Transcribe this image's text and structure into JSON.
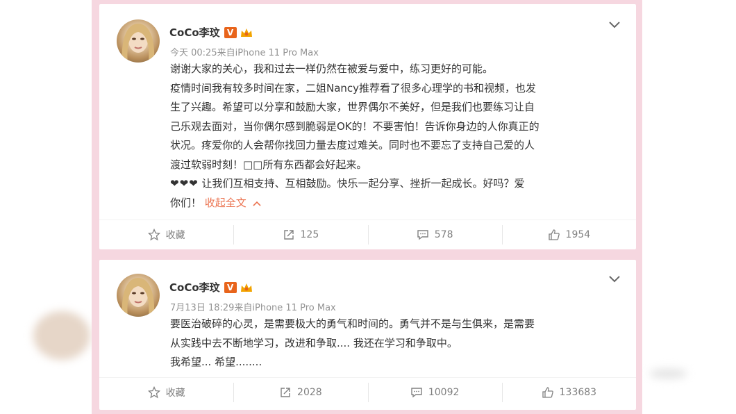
{
  "colors": {
    "frame": "#f6d7e0",
    "link": "#eb7350",
    "verified_badge": "#e8641b"
  },
  "posts": [
    {
      "author": "CoCo李玟",
      "verified_badge": "V",
      "meta": "今天 00:25来自iPhone 11 Pro Max",
      "paragraphs": [
        "谢谢大家的关心，我和过去一样仍然在被爱与爱中，练习更好的可能。",
        "疫情时间我有较多时间在家，二姐Nancy推荐看了很多心理学的书和视频，也发",
        "生了兴趣。希望可以分享和鼓励大家，世界偶尔不美好，但是我们也要练习让自",
        "己乐观去面对，当你偶尔感到脆弱是OK的！不要害怕！告诉你身边的人你真正的",
        "状况。疼爱你的人会帮你找回力量去度过难关。同时也不要忘了支持自己爱的人",
        "渡过软弱时刻！□□所有东西都会好起来。"
      ],
      "hearts": "❤❤❤",
      "last_line_1": "  让我们互相支持、互相鼓励。快乐一起分享、挫折一起成长。好吗？爱",
      "last_line_2": "你们！",
      "collapse_label": "收起全文",
      "actions": {
        "favorite": "收藏",
        "repost": "125",
        "comment": "578",
        "like": "1954"
      },
      "icons": [
        "star-icon",
        "repost-icon",
        "comment-icon",
        "thumbs-up-icon"
      ]
    },
    {
      "author": "CoCo李玟",
      "verified_badge": "V",
      "meta": "7月13日 18:29来自iPhone 11 Pro Max",
      "paragraphs": [
        "要医治破碎的心灵，是需要极大的勇气和时间的。勇气并不是与生俱来，是需要",
        "从实践中去不断地学习，改进和争取.... 我还在学习和争取中。",
        "我希望...    希望........"
      ],
      "actions": {
        "favorite": "收藏",
        "repost": "2028",
        "comment": "10092",
        "like": "133683"
      },
      "icons": [
        "star-icon",
        "repost-icon",
        "comment-icon",
        "thumbs-up-icon"
      ]
    }
  ]
}
